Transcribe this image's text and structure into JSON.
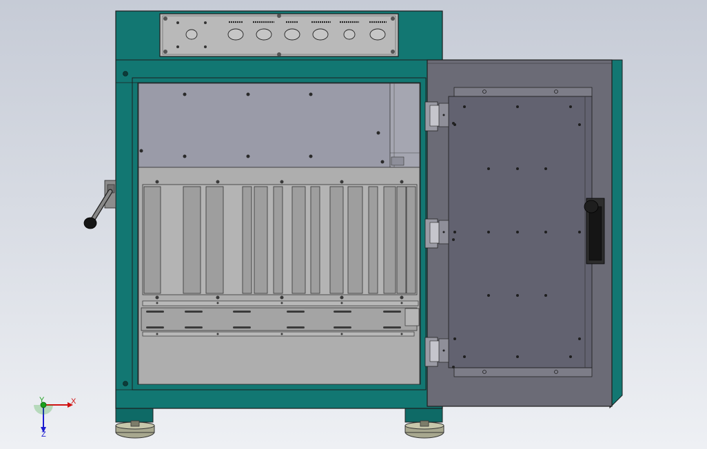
{
  "panel_labels": [
    "",
    "",
    "",
    "",
    "",
    "",
    ""
  ],
  "axis_triad": {
    "x": "X",
    "y": "Y",
    "z": "Z"
  },
  "colors": {
    "body": "#127772",
    "body_dark": "#0b514e",
    "interior_upper": "#9a9ba8",
    "interior_lower": "#aeaeae",
    "door_panel": "#6b6b76",
    "door_inner_plate": "#626270",
    "handle": "#1b1b1b",
    "rail": "#a4a4a4",
    "foot": "#a8a88f"
  }
}
